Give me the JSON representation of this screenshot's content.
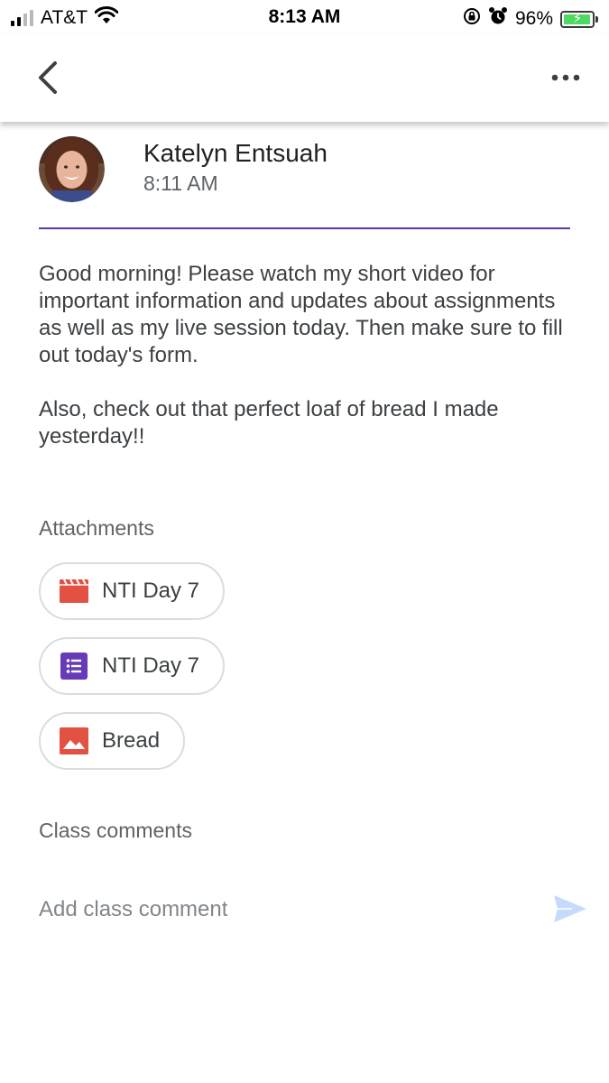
{
  "status_bar": {
    "carrier": "AT&T",
    "time": "8:13 AM",
    "battery_percent": "96%",
    "battery_level": 0.96,
    "signal_bars_active": 2,
    "signal_bars_total": 4,
    "icons": [
      "signal-icon",
      "wifi-icon",
      "orientation-lock-icon",
      "alarm-icon",
      "battery-icon"
    ]
  },
  "app_bar": {
    "icons": [
      "back-icon",
      "more-options-icon"
    ]
  },
  "post": {
    "author": "Katelyn Entsuah",
    "time": "8:11 AM",
    "body": [
      "Good morning! Please watch my short video for important information and updates about assignments as well as my live session today. Then make sure to fill out today's form.",
      "Also, check out that perfect loaf of bread I made yesterday!!"
    ]
  },
  "attachments": {
    "heading": "Attachments",
    "items": [
      {
        "label": "NTI Day 7",
        "icon": "video-icon",
        "color": "#e25141"
      },
      {
        "label": "NTI Day 7",
        "icon": "form-icon",
        "color": "#673ab7"
      },
      {
        "label": "Bread",
        "icon": "image-icon",
        "color": "#e25141"
      }
    ]
  },
  "comments": {
    "heading": "Class comments",
    "placeholder": "Add class comment",
    "send_icon": "send-icon"
  },
  "colors": {
    "accent": "#5e35b1",
    "send_disabled": "#c6dafc",
    "battery_green": "#4cd964"
  }
}
